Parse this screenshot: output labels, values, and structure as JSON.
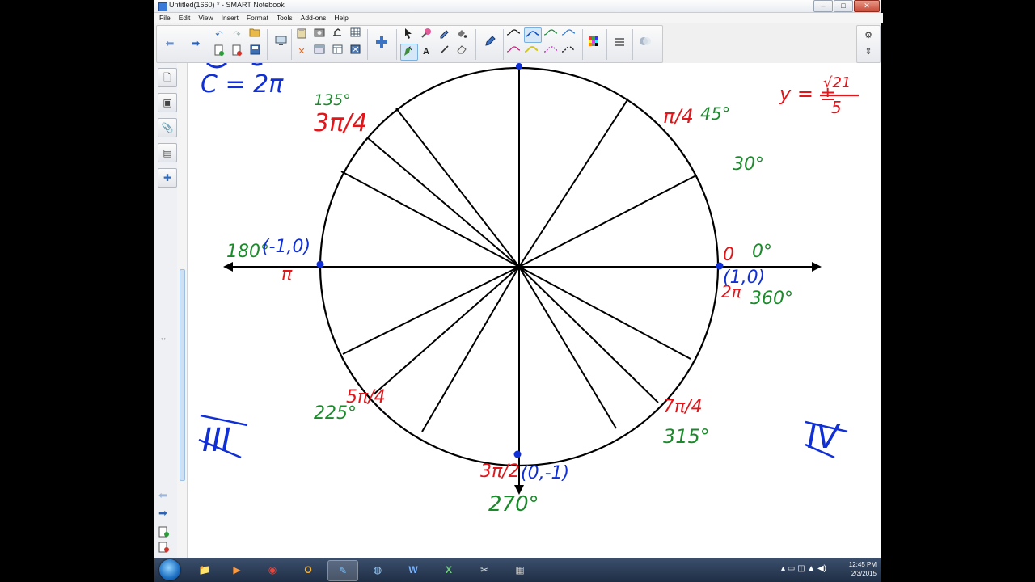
{
  "window": {
    "title": "Untitled(1660) * - SMART Notebook",
    "minimize": "–",
    "maximize": "□",
    "close": "✕"
  },
  "menu": [
    "File",
    "Edit",
    "View",
    "Insert",
    "Format",
    "Tools",
    "Add-ons",
    "Help"
  ],
  "toolbar": {
    "back_icon": "⬅",
    "forward_icon": "➡",
    "undo_icon": "↶",
    "redo_icon": "↷",
    "gear_icon": "⚙",
    "arrows_icon": "⇕"
  },
  "sidebar": {
    "icons": [
      "🗋",
      "▣",
      "📎",
      "▤",
      "✚"
    ],
    "resize_handle": "↔"
  },
  "notes": {
    "circumference": "C = 2π",
    "top_fragment": "y = ± √21 / 5",
    "top_fragment_line1": "y = ±",
    "top_fragment_num": "√21",
    "top_fragment_den": "5",
    "q3": "III",
    "q4": "IV",
    "deg135": "135°",
    "rad135": "3π/4",
    "rad45": "π/4",
    "deg45": "45°",
    "deg30": "30°",
    "deg180": "180°",
    "pt180": "(-1,0)",
    "rad180": "π",
    "rad0": "0",
    "deg0": "0°",
    "pt0": "(1,0)",
    "rad360": "2π",
    "deg360": "360°",
    "rad225": "5π/4",
    "deg225": "225°",
    "rad315": "7π/4",
    "deg315": "315°",
    "rad270": "3π/2",
    "pt270": "(0,-1)",
    "deg270": "270°"
  },
  "colors": {
    "red": "#e0161b",
    "green": "#1b8a2b",
    "blue": "#1030d6",
    "black": "#000000"
  },
  "taskbar": {
    "apps": [
      "📁",
      "▶",
      "◉",
      "O",
      "✎",
      "◍",
      "W",
      "X",
      "✂",
      "▦"
    ],
    "time": "12:45 PM",
    "date": "2/3/2015"
  }
}
